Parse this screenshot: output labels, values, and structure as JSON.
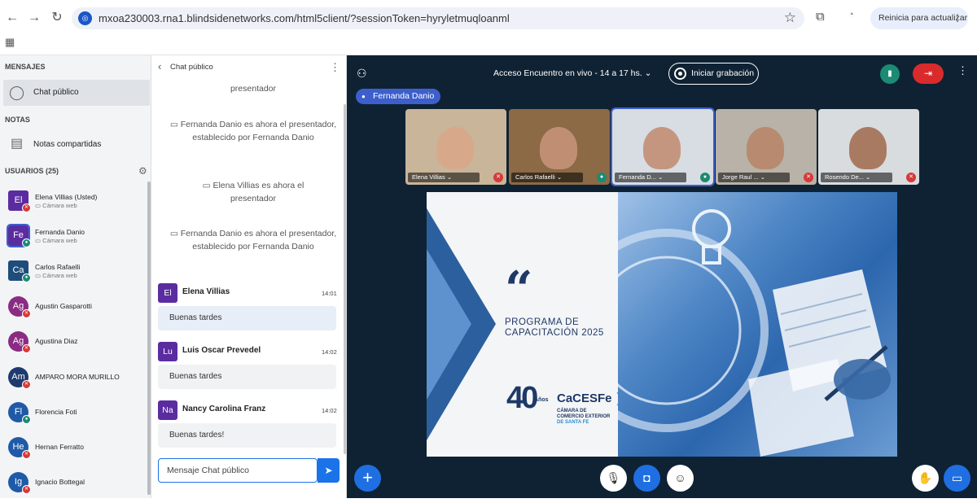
{
  "browser": {
    "url": "mxoa230003.rna1.blindsidenetworks.com/html5client/?sessionToken=hyryletmuqloanml",
    "update_label": "Reinicia para actualizar"
  },
  "sidebar": {
    "messages_title": "MENSAJES",
    "public_chat_label": "Chat público",
    "notes_title": "NOTAS",
    "shared_notes_label": "Notas compartidas",
    "users_title": "USUARIOS (25)",
    "users": [
      {
        "initials": "El",
        "name": "Elena Villias (Usted)",
        "sub": "Cámara web",
        "color": "#5b2ca0",
        "mic": "#d63a3a"
      },
      {
        "initials": "Fe",
        "name": "Fernanda Danio",
        "sub": "Cámara web",
        "color": "#5b2ca0",
        "mic": "#1b8b73"
      },
      {
        "initials": "Ca",
        "name": "Carlos Rafaelli",
        "sub": "Cámara web",
        "color": "#1e4d7b",
        "mic": "#1b8b73"
      },
      {
        "initials": "Ag",
        "name": "Agustin Gasparotti",
        "sub": "",
        "color": "#8a2c83",
        "mic": "#d63a3a"
      },
      {
        "initials": "Ag",
        "name": "Agustina Diaz",
        "sub": "",
        "color": "#8a2c83",
        "mic": "#d63a3a"
      },
      {
        "initials": "Am",
        "name": "AMPARO MORA MURILLO",
        "sub": "",
        "color": "#1e3a6e",
        "mic": "#d63a3a"
      },
      {
        "initials": "Fl",
        "name": "Florencia Foti",
        "sub": "",
        "color": "#1f5aa8",
        "mic": "#1b8b73"
      },
      {
        "initials": "He",
        "name": "Hernan Ferratto",
        "sub": "",
        "color": "#1f5aa8",
        "mic": "#d63a3a"
      },
      {
        "initials": "Ig",
        "name": "Ignacio Bottegal",
        "sub": "",
        "color": "#1f5aa8",
        "mic": "#d63a3a"
      }
    ]
  },
  "chat": {
    "title": "Chat público",
    "system_messages": [
      "presentador",
      "Fernanda Danio es ahora el presentador, establecido por Fernanda Danio",
      "Elena Villias es ahora el presentador",
      "Fernanda Danio es ahora el presentador, establecido por Fernanda Danio"
    ],
    "messages": [
      {
        "initials": "El",
        "name": "Elena Villias",
        "time": "14:01",
        "text": "Buenas tardes"
      },
      {
        "initials": "Lu",
        "name": "Luis Oscar Prevedel",
        "time": "14:02",
        "text": "Buenas tardes"
      },
      {
        "initials": "Na",
        "name": "Nancy Carolina Franz",
        "time": "14:02",
        "text": "Buenas tardes!"
      }
    ],
    "input_placeholder": "Mensaje Chat público"
  },
  "meeting": {
    "title": "Acceso Encuentro en vivo - 14 a 17 hs.",
    "record_label": "Iniciar grabación",
    "presenter": "Fernanda Danio",
    "videos": [
      {
        "name": "Elena Villias",
        "bg": "#c9b59a",
        "skin": "#d7a98a",
        "mic": "#d63a3a"
      },
      {
        "name": "Carlos Rafaelli",
        "bg": "#8b6a45",
        "skin": "#c08f73",
        "mic": "#1b8b73"
      },
      {
        "name": "Fernanda D...",
        "bg": "#d8dde3",
        "skin": "#c49680",
        "mic": "#1b8b73"
      },
      {
        "name": "Jorge Raul ...",
        "bg": "#b8b2a8",
        "skin": "#b88a6f",
        "mic": "#d63a3a"
      },
      {
        "name": "Rosendo De...",
        "bg": "#d9dcdf",
        "skin": "#a97a62",
        "mic": "#d63a3a"
      }
    ]
  },
  "slide": {
    "quote": "“",
    "line1": "PROGRAMA DE",
    "line2": "CAPACITACIÓN  2025",
    "logo_number": "40",
    "logo_anios": "Años",
    "logo_brand": "CaCESFe",
    "logo_sub1": "CÁMARA DE",
    "logo_sub2": "COMERCIO EXTERIOR",
    "logo_sub3": "DE SANTA FE"
  }
}
